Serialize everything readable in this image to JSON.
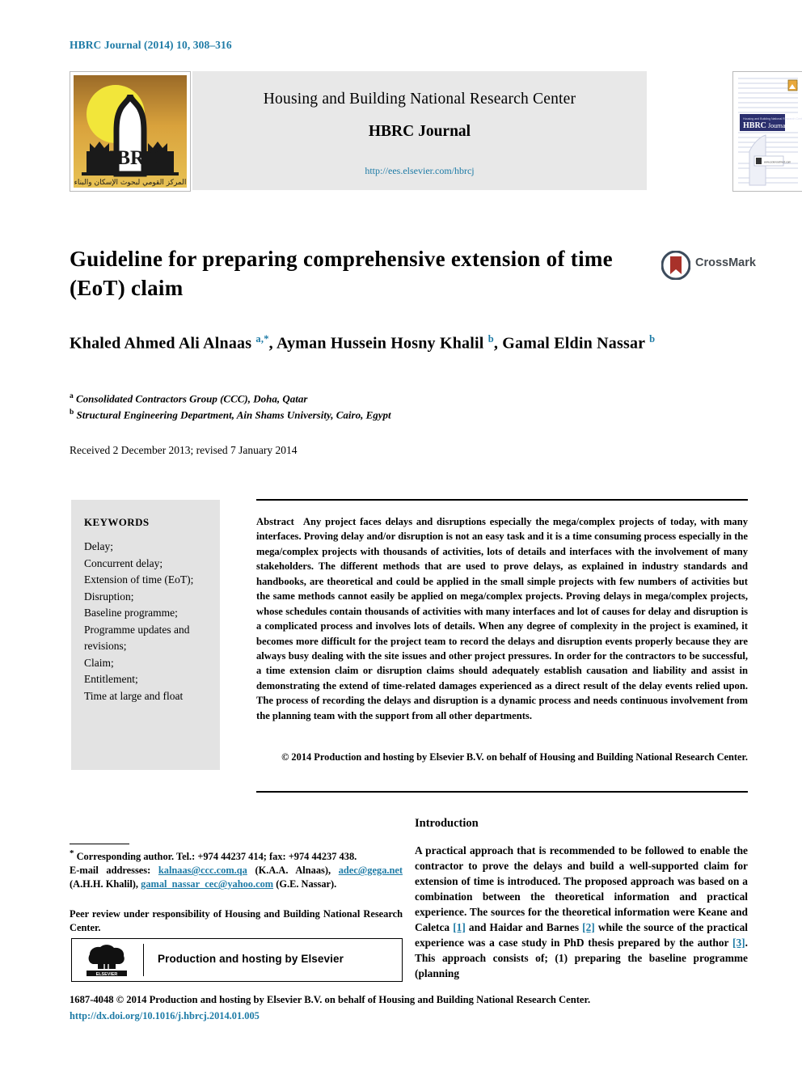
{
  "running_head": "HBRC Journal (2014) 10, 308–316",
  "journal_header": {
    "center_line1": "Housing and Building National Research Center",
    "center_line2": "HBRC Journal",
    "url": "http://ees.elsevier.com/hbrcj",
    "logo_text": "HBRC",
    "logo_arabic": "المركز القومي لبحوث الإسكان والبناء",
    "cover_text": "HBRC Journal",
    "cover_sub": "Housing and Building National Research Center"
  },
  "article": {
    "title": "Guideline for preparing comprehensive extension of time (EoT) claim",
    "crossmark_label": "CrossMark",
    "authors_html": "Khaled Ahmed Ali Alnaas <sup>a,*</sup>, Ayman Hussein Hosny Khalil <sup>b</sup>, Gamal Eldin Nassar <sup>b</sup>",
    "affiliations": [
      {
        "marker": "a",
        "text": "Consolidated Contractors Group (CCC), Doha, Qatar"
      },
      {
        "marker": "b",
        "text": "Structural Engineering Department, Ain Shams University, Cairo, Egypt"
      }
    ],
    "received": "Received 2 December 2013; revised 7 January 2014"
  },
  "keywords": {
    "heading": "KEYWORDS",
    "items": [
      "Delay;",
      "Concurrent delay;",
      "Extension of time (EoT);",
      "Disruption;",
      "Baseline programme;",
      "Programme updates and revisions;",
      "Claim;",
      "Entitlement;",
      "Time at large and float"
    ]
  },
  "abstract": {
    "label": "Abstract",
    "body": "Any project faces delays and disruptions especially the mega/complex projects of today, with many interfaces. Proving delay and/or disruption is not an easy task and it is a time consuming process especially in the mega/complex projects with thousands of activities, lots of details and interfaces with the involvement of many stakeholders. The different methods that are used to prove delays, as explained in industry standards and handbooks, are theoretical and could be applied in the small simple projects with few numbers of activities but the same methods cannot easily be applied on mega/complex projects. Proving delays in mega/complex projects, whose schedules contain thousands of activities with many interfaces and lot of causes for delay and disruption is a complicated process and involves lots of details. When any degree of complexity in the project is examined, it becomes more difficult for the project team to record the delays and disruption events properly because they are always busy dealing with the site issues and other project pressures. In order for the contractors to be successful, a time extension claim or disruption claims should adequately establish causation and liability and assist in demonstrating the extend of time-related damages experienced as a direct result of the delay events relied upon. The process of recording the delays and disruption is a dynamic process and needs continuous involvement from the planning team with the support from all other departments.",
    "copyright": "© 2014 Production and hosting by Elsevier B.V. on behalf of Housing and Building National Research Center."
  },
  "footnote": {
    "corresponding": "Corresponding author. Tel.: +974 44237 414; fax: +974 44237 438.",
    "email_label": "E-mail addresses:",
    "emails": [
      {
        "address": "kalnaas@ccc.com.qa",
        "owner": "(K.A.A. Alnaas)"
      },
      {
        "address": "adec@gega.net",
        "owner": "(A.H.H. Khalil)"
      },
      {
        "address": "gamal_nassar_cec@yahoo.com",
        "owner": "(G.E. Nassar)"
      }
    ],
    "peer_review": "Peer review under responsibility of Housing and Building National Research Center.",
    "elsevier_box_text": "Production and hosting by Elsevier",
    "elsevier_logo_text": "ELSEVIER"
  },
  "introduction": {
    "heading": "Introduction",
    "paragraph_parts": [
      "A practical approach that is recommended to be followed to enable the contractor to prove the delays and build a well-supported claim for extension of time is introduced. The proposed approach was based on a combination between the theoretical information and practical experience. The sources for the theoretical information were Keane and Caletca ",
      "[1]",
      " and Haidar and Barnes ",
      "[2]",
      " while the source of the practical experience was a case study in PhD thesis prepared by the author ",
      "[3]",
      ". This approach consists of; (1) preparing the baseline programme (planning"
    ]
  },
  "page_footer": {
    "line1": "1687-4048 © 2014 Production and hosting by Elsevier B.V. on behalf of Housing and Building National Research Center.",
    "doi": "http://dx.doi.org/10.1016/j.hbrcj.2014.01.005"
  },
  "colors": {
    "accent_blue": "#1e7ba6",
    "header_gray": "#e8e8e8",
    "keyword_gray": "#e3e3e3",
    "crossmark_red": "#a8312a",
    "crossmark_navy": "#3c4b5c"
  }
}
